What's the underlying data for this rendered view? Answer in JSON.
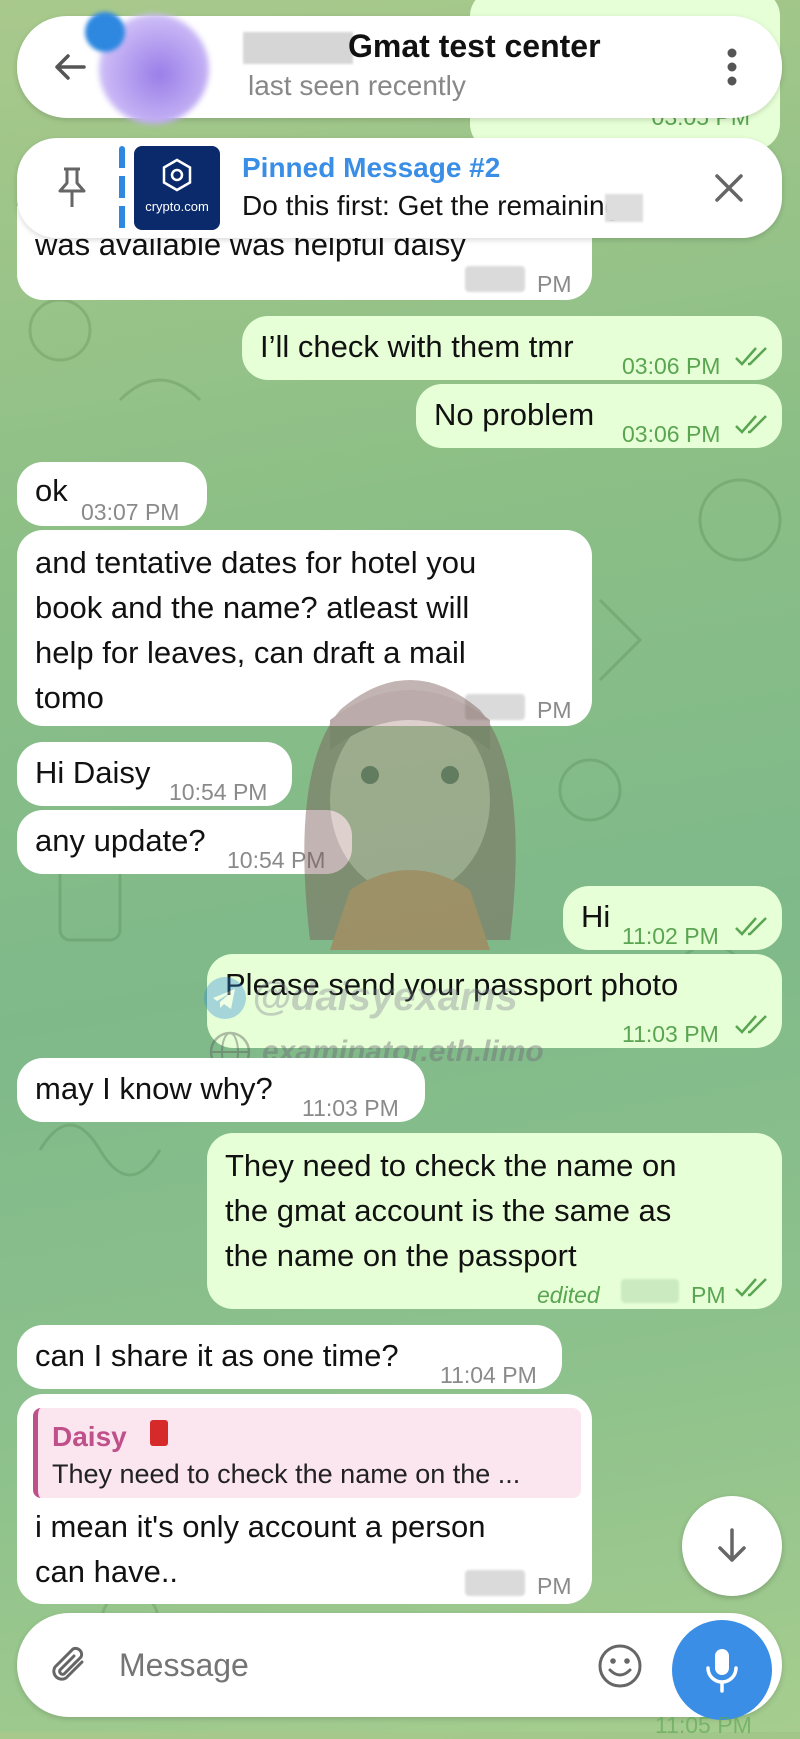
{
  "header": {
    "contact_name": "Gmat test center",
    "status": "last seen recently"
  },
  "pinned": {
    "title": "Pinned Message #2",
    "text": "Do this first: Get the remaining",
    "thumb_label": "crypto.com"
  },
  "messages": [
    {
      "text": "was available was helpful daisy",
      "time": "PM"
    },
    {
      "text": "I’ll check with them tmr",
      "time": "03:06 PM"
    },
    {
      "text": "No problem",
      "time": "03:06 PM"
    },
    {
      "text": "ok",
      "time": "03:07 PM"
    },
    {
      "line1": "and tentative dates for hotel you",
      "line2": "book and the name? atleast will",
      "line3": "help for leaves, can draft a mail",
      "line4": "tomo",
      "time": "PM"
    },
    {
      "text": "Hi Daisy",
      "time": "10:54 PM"
    },
    {
      "text": "any update?",
      "time": "10:54 PM"
    },
    {
      "text": "Hi",
      "time": "11:02 PM"
    },
    {
      "text": "Please send your passport photo",
      "time": "11:03 PM"
    },
    {
      "text": "may I know why?",
      "time": "11:03 PM"
    },
    {
      "line1": "They need to check the name on",
      "line2": "the gmat account is the same as",
      "line3": "the name on the passport",
      "edited": "edited",
      "time": "PM"
    },
    {
      "text": "can I share it as one time?",
      "time": "11:04 PM"
    },
    {
      "reply_name": "Daisy",
      "reply_text": "They need to check the name on the ...",
      "line1": "i mean it's only account a person",
      "line2": "can have..",
      "time": "PM"
    }
  ],
  "watermark": {
    "handle": "@daisyexams",
    "site": "examinator.eth.limo"
  },
  "composer": {
    "placeholder": "Message"
  },
  "top_peek_time": "03:05 PM",
  "bottom_peek_time": "11:05 PM",
  "colors": {
    "accent": "#3a8ee6",
    "outgoing": "#e6ffd6",
    "incoming": "#ffffff",
    "reply_name": "#c0508a"
  }
}
